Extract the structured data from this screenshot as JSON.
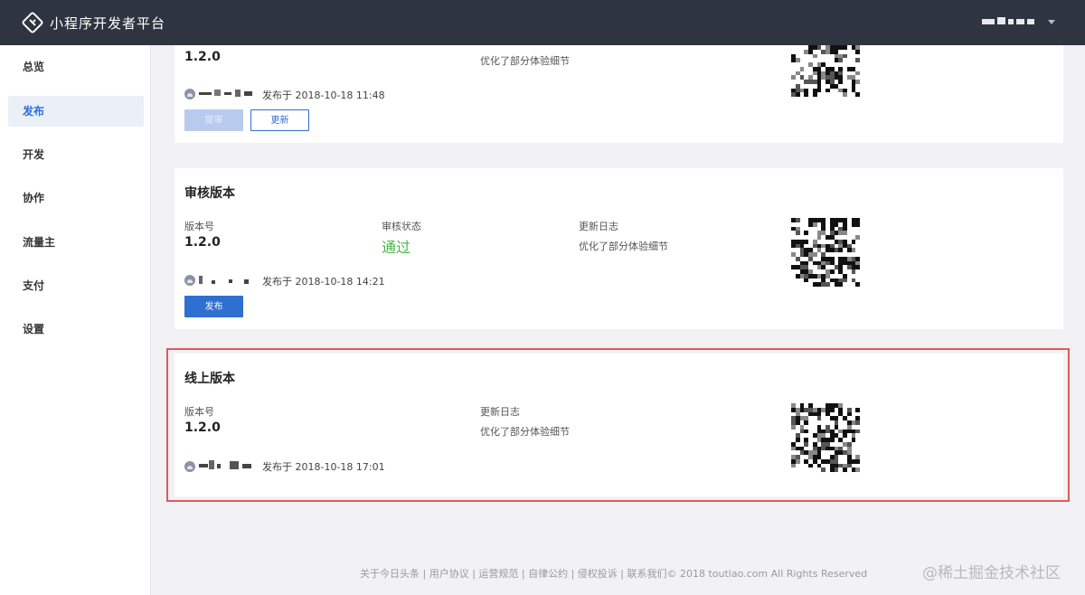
{
  "header": {
    "app_title": "小程序开发者平台"
  },
  "sidebar": {
    "items": [
      {
        "label": "总览",
        "active": false
      },
      {
        "label": "发布",
        "active": true
      },
      {
        "label": "开发",
        "active": false
      },
      {
        "label": "协作",
        "active": false
      },
      {
        "label": "流量主",
        "active": false
      },
      {
        "label": "支付",
        "active": false
      },
      {
        "label": "设置",
        "active": false
      }
    ]
  },
  "dev_version": {
    "version": "1.2.0",
    "changelog": "优化了部分体验细节",
    "meta": "发布于 2018-10-18 11:48",
    "submit_label": "提审",
    "update_label": "更新"
  },
  "review_version": {
    "title": "审核版本",
    "version_label": "版本号",
    "version": "1.2.0",
    "status_label": "审核状态",
    "status": "通过",
    "changelog_label": "更新日志",
    "changelog": "优化了部分体验细节",
    "meta": "发布于 2018-10-18 14:21",
    "publish_label": "发布"
  },
  "online_version": {
    "title": "线上版本",
    "version_label": "版本号",
    "version": "1.2.0",
    "changelog_label": "更新日志",
    "changelog": "优化了部分体验细节",
    "meta": "发布于 2018-10-18 17:01"
  },
  "footer": {
    "links": "关于今日头条 | 用户协议 | 运营规范 | 自律公约 | 侵权投诉 | 联系我们© 2018 toutiao.com All Rights Reserved"
  },
  "watermark": "@稀土掘金技术社区",
  "colors": {
    "topbar": "#2e3440",
    "accent": "#2e6fd0",
    "status_pass": "#4ab54a",
    "highlight": "#e05a5a"
  }
}
